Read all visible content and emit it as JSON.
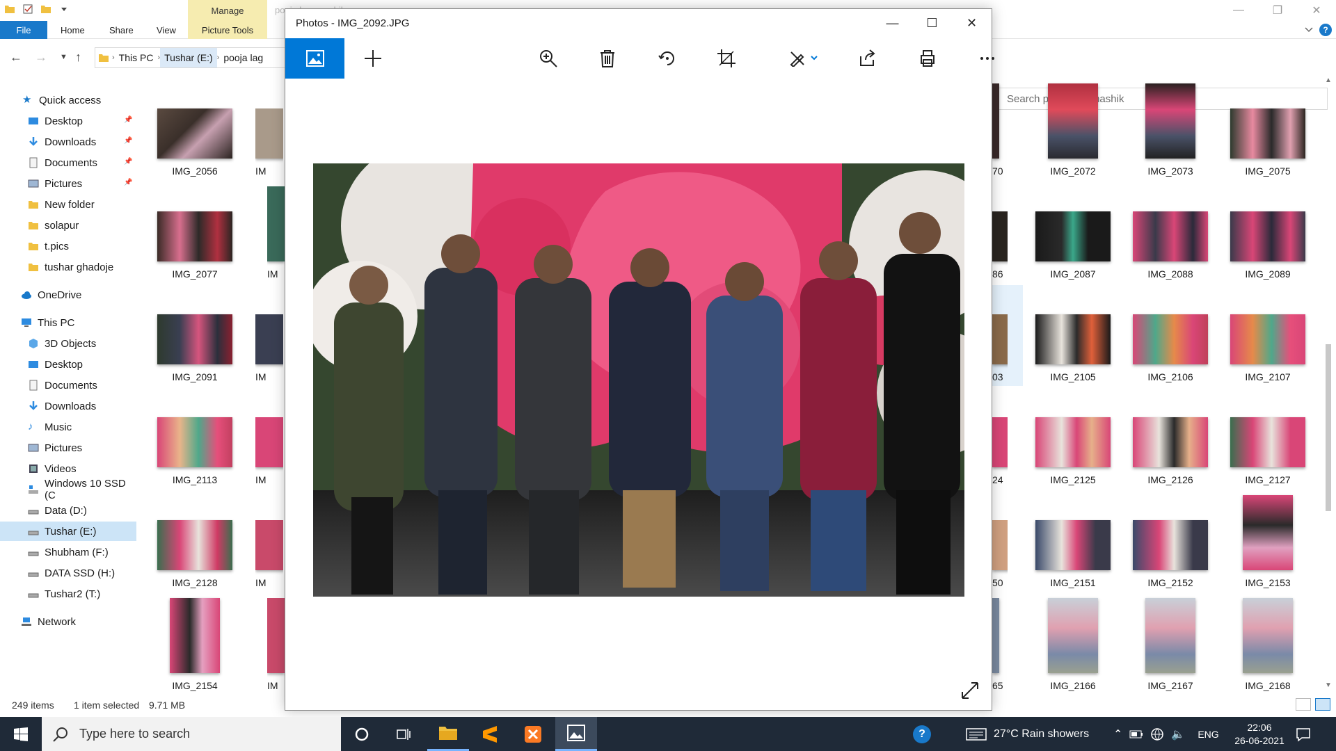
{
  "explorer": {
    "ribbon": {
      "manage": "Manage",
      "tabs": [
        "File",
        "Home",
        "Share",
        "View",
        "Picture Tools"
      ],
      "faint_title": "pooja lagn nashik"
    },
    "address": {
      "segments": [
        "This PC",
        "Tushar (E:)",
        "pooja lag"
      ]
    },
    "search_placeholder": "Search pooja lagn nashik",
    "nav": {
      "quick_access": "Quick access",
      "quick_items": [
        "Desktop",
        "Downloads",
        "Documents",
        "Pictures",
        "New folder",
        "solapur",
        "t.pics",
        "tushar ghadoje"
      ],
      "onedrive": "OneDrive",
      "this_pc": "This PC",
      "pc_items": [
        "3D Objects",
        "Desktop",
        "Documents",
        "Downloads",
        "Music",
        "Pictures",
        "Videos",
        "Windows 10 SSD (C",
        "Data (D:)",
        "Tushar (E:)",
        "Shubham (F:)",
        "DATA SSD (H:)",
        "Tushar2 (T:)"
      ],
      "network": "Network"
    },
    "files_left": [
      {
        "name": "IMG_2056",
        "cut": "IM"
      },
      {
        "name": "IMG_2077",
        "cut": "IM"
      },
      {
        "name": "IMG_2091",
        "cut": "IM"
      },
      {
        "name": "IMG_2113",
        "cut": "IM"
      },
      {
        "name": "IMG_2128",
        "cut": "IM"
      },
      {
        "name": "IMG_2154",
        "cut": "IM"
      }
    ],
    "files_right_cut": [
      "70",
      "86",
      "03",
      "24",
      "50",
      "65"
    ],
    "files_right": [
      [
        "IMG_2072",
        "IMG_2073",
        "IMG_2075"
      ],
      [
        "IMG_2087",
        "IMG_2088",
        "IMG_2089"
      ],
      [
        "IMG_2105",
        "IMG_2106",
        "IMG_2107"
      ],
      [
        "IMG_2125",
        "IMG_2126",
        "IMG_2127"
      ],
      [
        "IMG_2151",
        "IMG_2152",
        "IMG_2153"
      ],
      [
        "IMG_2166",
        "IMG_2167",
        "IMG_2168"
      ]
    ],
    "status": {
      "count": "249 items",
      "selected": "1 item selected",
      "size": "9.71 MB"
    }
  },
  "photos": {
    "title": "Photos - IMG_2092.JPG",
    "toolbar_icons": [
      "view-icon",
      "add-icon",
      "zoom-icon",
      "delete-icon",
      "rotate-icon",
      "crop-icon",
      "edit-icon",
      "share-icon",
      "print-icon",
      "more-icon"
    ]
  },
  "taskbar": {
    "search_placeholder": "Type here to search",
    "weather": "27°C  Rain showers",
    "lang": "ENG",
    "time": "22:06",
    "date": "26-06-2021"
  },
  "colors": {
    "accent": "#0078d7",
    "file_tab": "#1979ca",
    "manage_tab": "#f6ecb0",
    "taskbar": "#1f2a38",
    "nav_selected": "#cce4f7"
  }
}
